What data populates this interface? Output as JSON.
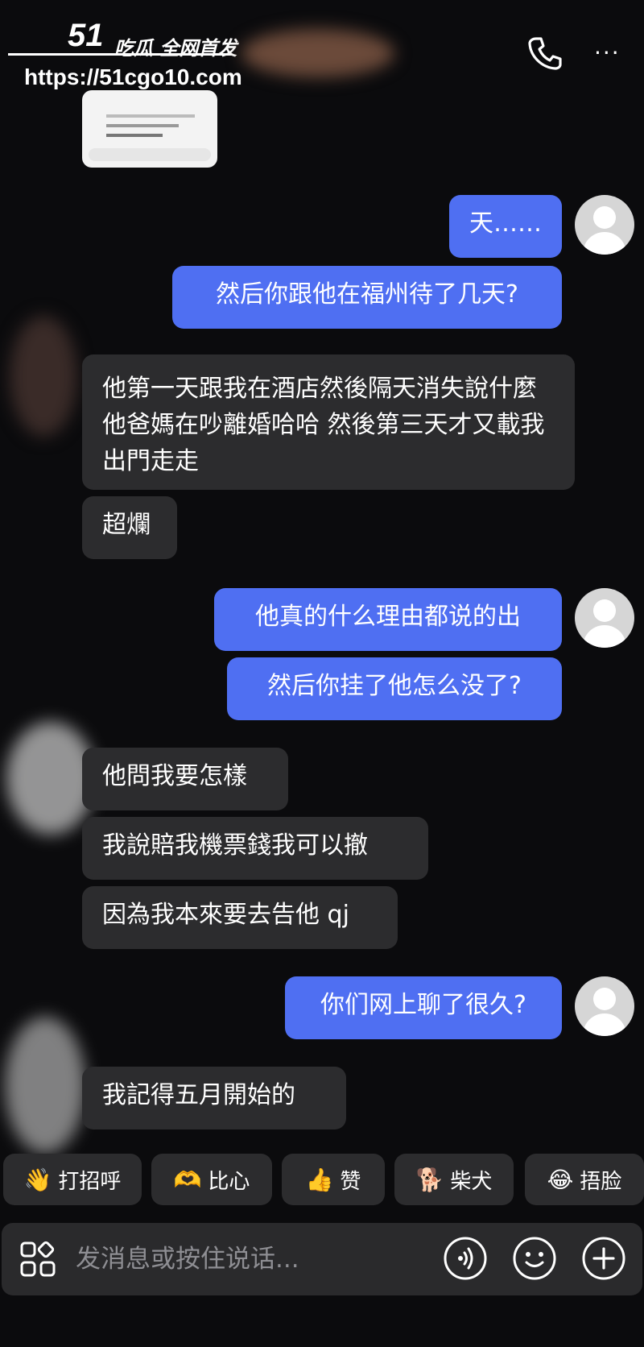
{
  "watermark": {
    "logo_num": "51",
    "logo_text": "吃瓜 全网首发",
    "url": "https://51cgo10.com"
  },
  "header": {
    "call_icon": "phone-icon",
    "more_icon": "more-icon",
    "more_label": "···"
  },
  "messages": [
    {
      "side": "out",
      "text": "天……"
    },
    {
      "side": "out",
      "text": "然后你跟他在福州待了几天?"
    },
    {
      "side": "in",
      "text": "他第一天跟我在酒店然後隔天消失說什麼他爸媽在吵離婚哈哈 然後第三天才又載我出門走走"
    },
    {
      "side": "in",
      "text": "超爛"
    },
    {
      "side": "out",
      "text": "他真的什么理由都说的出"
    },
    {
      "side": "out",
      "text": "然后你挂了他怎么没了?"
    },
    {
      "side": "in",
      "text": "他問我要怎樣"
    },
    {
      "side": "in",
      "text": "我說賠我機票錢我可以撤"
    },
    {
      "side": "in",
      "text": "因為我本來要去告他 qj"
    },
    {
      "side": "out",
      "text": "你们网上聊了很久?"
    },
    {
      "side": "in",
      "text": "我記得五月開始的"
    }
  ],
  "quick_replies": [
    {
      "emoji": "👋",
      "label": "打招呼"
    },
    {
      "emoji": "🫶",
      "label": "比心"
    },
    {
      "emoji": "👍",
      "label": "赞"
    },
    {
      "emoji": "🐕",
      "label": "柴犬"
    },
    {
      "emoji": "😂",
      "label": "捂脸"
    }
  ],
  "input": {
    "placeholder": "发消息或按住说话..."
  },
  "colors": {
    "background": "#0b0b0d",
    "outgoing_bubble": "#4f6ff2",
    "incoming_bubble": "#2c2c2e"
  }
}
